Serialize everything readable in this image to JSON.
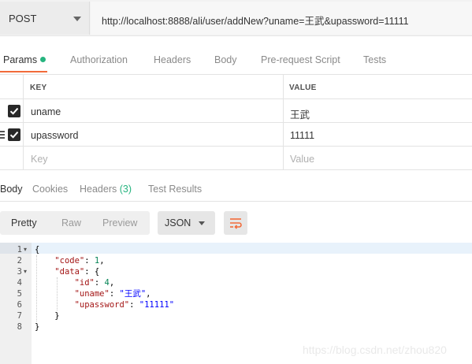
{
  "request": {
    "method": "POST",
    "url": "http://localhost:8888/ali/user/addNew?uname=王武&upassword=11111"
  },
  "request_tabs": {
    "params": "Params",
    "authorization": "Authorization",
    "headers": "Headers",
    "body": "Body",
    "pre_request_script": "Pre-request Script",
    "tests": "Tests"
  },
  "params_table": {
    "key_header": "KEY",
    "value_header": "VALUE",
    "rows": [
      {
        "key": "uname",
        "value": "王武",
        "checked": true
      },
      {
        "key": "upassword",
        "value": "11111",
        "checked": true
      }
    ],
    "new_row": {
      "key_placeholder": "Key",
      "value_placeholder": "Value"
    }
  },
  "response_tabs": {
    "body": "Body",
    "cookies": "Cookies",
    "headers": "Headers",
    "headers_count": "(3)",
    "test_results": "Test Results"
  },
  "response_toolbar": {
    "pretty": "Pretty",
    "raw": "Raw",
    "preview": "Preview",
    "format": "JSON"
  },
  "editor": {
    "line_numbers": [
      "1",
      "2",
      "3",
      "4",
      "5",
      "6",
      "7",
      "8"
    ],
    "lines": {
      "l1": "{",
      "l2_key": "\"code\"",
      "l2_val": "1",
      "l3_key": "\"data\"",
      "l3_open": "{",
      "l4_key": "\"id\"",
      "l4_val": "4",
      "l5_key": "\"uname\"",
      "l5_val": "\"王武\"",
      "l6_key": "\"upassword\"",
      "l6_val": "\"11111\"",
      "l7": "}",
      "l8": "}"
    }
  },
  "watermark": "https://blog.csdn.net/zhou820",
  "colors": {
    "accent_orange": "#f26b3a",
    "status_green": "#26b47f"
  }
}
